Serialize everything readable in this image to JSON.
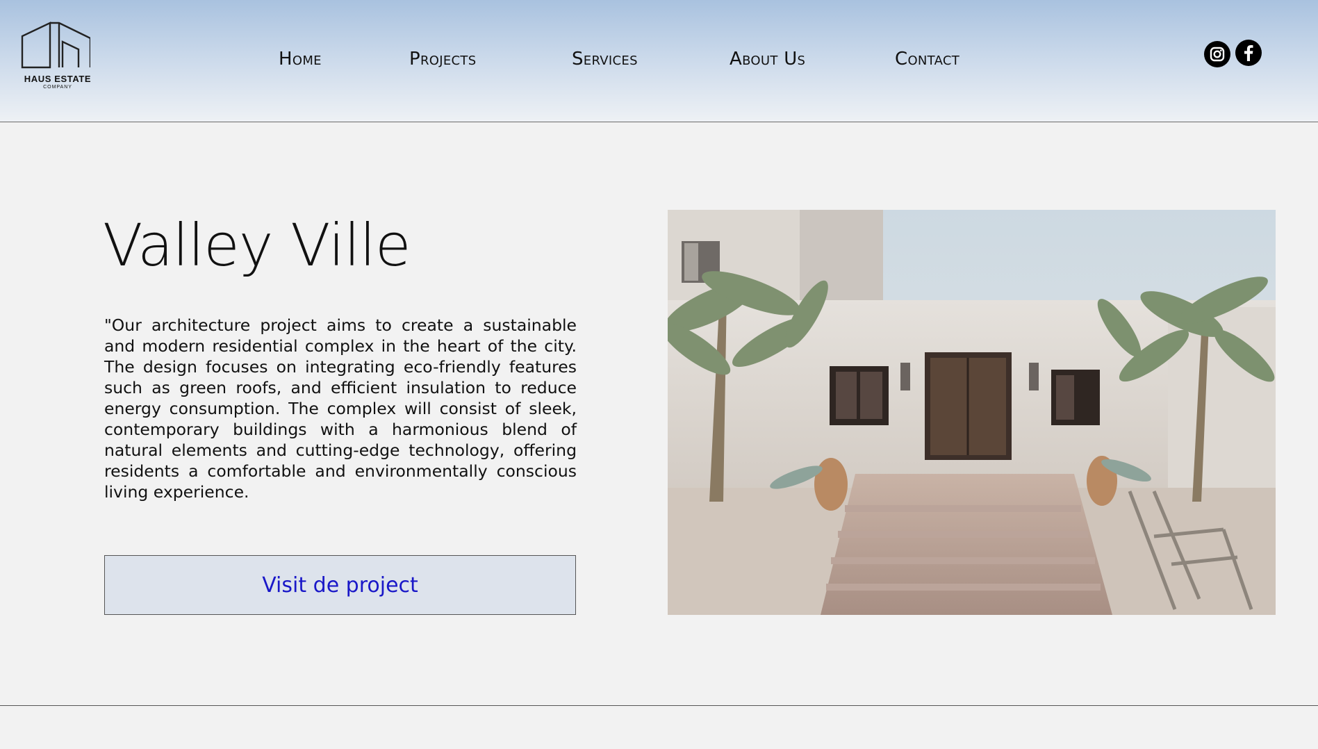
{
  "brand": {
    "name": "HAUS ESTATE",
    "tagline": "COMPANY"
  },
  "nav": {
    "items": [
      {
        "label": "Home"
      },
      {
        "label": "Projects"
      },
      {
        "label": "Services"
      },
      {
        "label": "About Us"
      },
      {
        "label": "Contact"
      }
    ]
  },
  "social": {
    "icons": [
      "instagram-icon",
      "facebook-icon"
    ]
  },
  "project": {
    "title": "Valley Ville",
    "description": "\"Our architecture project aims to create a sustainable and modern residential complex in the heart of the city. The design focuses on integrating eco-friendly features such as green roofs, and efficient insulation to reduce energy consumption. The complex will consist of sleek, contemporary buildings with a harmonious blend of natural elements and cutting-edge technology, offering residents a comfortable and environmentally conscious living experience.",
    "cta_label": "Visit de project"
  },
  "colors": {
    "header_top": "#a9c2df",
    "background": "#f2f2f2",
    "cta_background": "#dde3ec",
    "cta_text": "#1a18c8"
  }
}
